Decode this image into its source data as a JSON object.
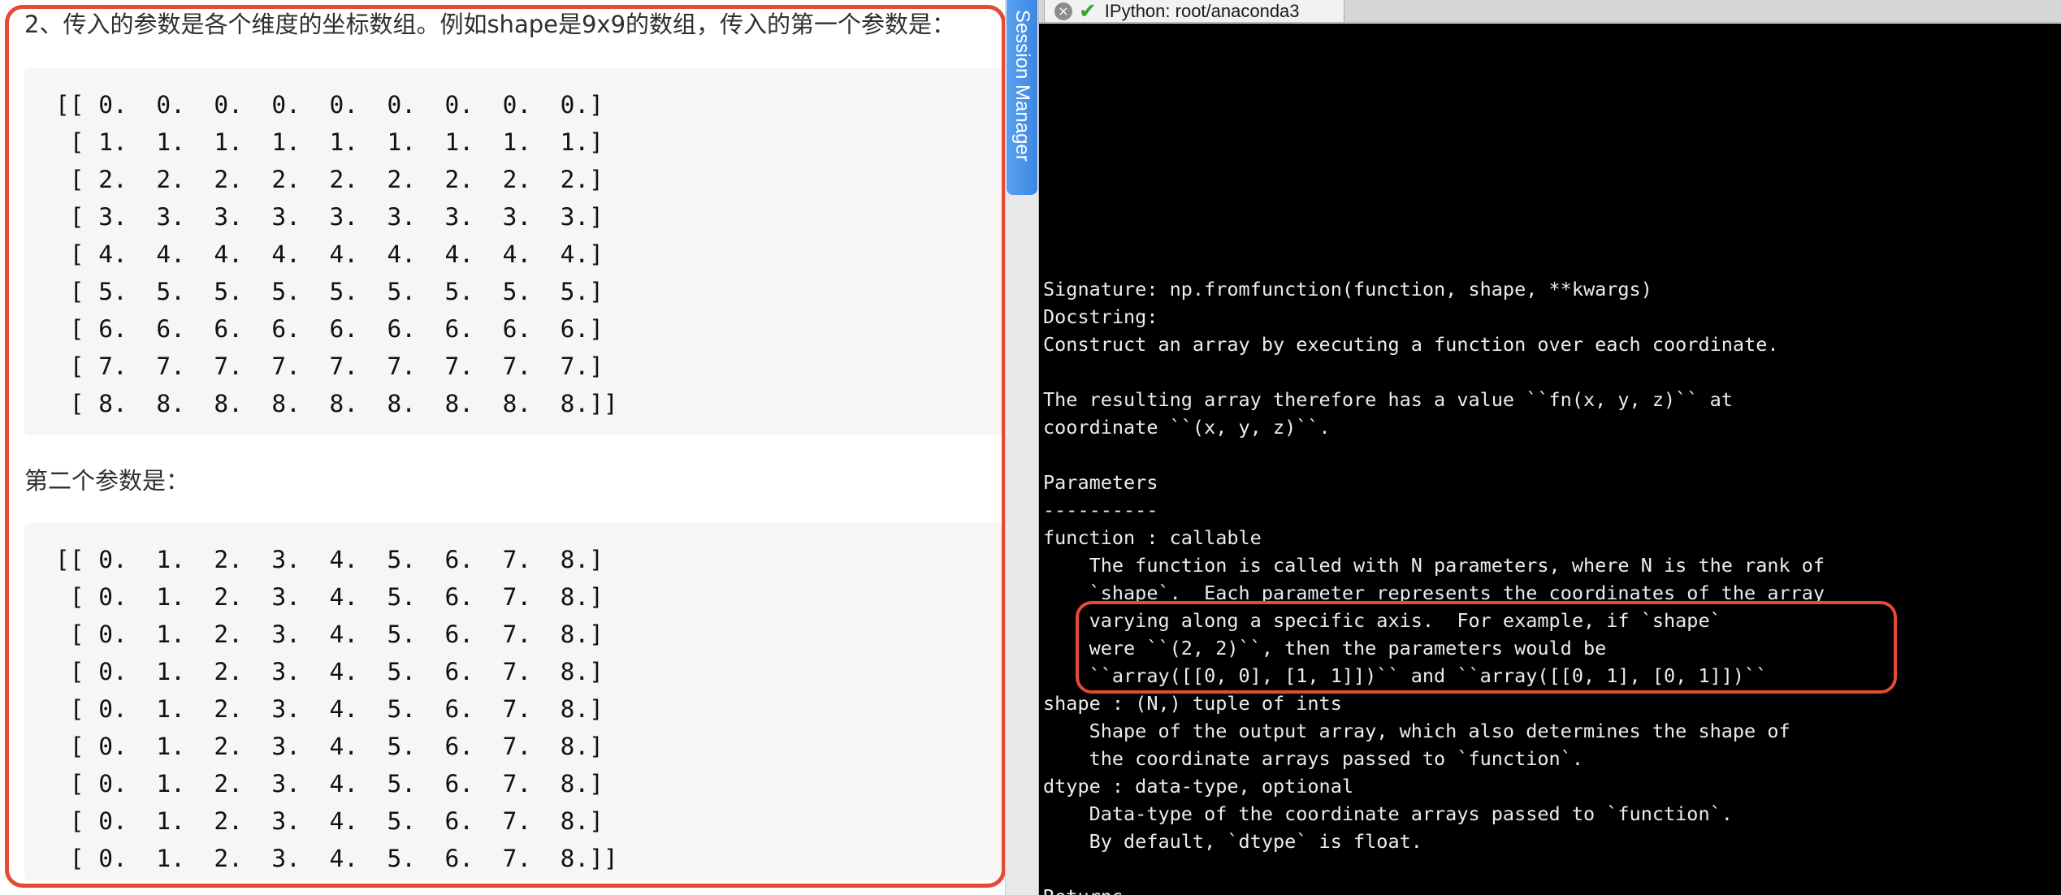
{
  "article": {
    "para1": "2、传入的参数是各个维度的坐标数组。例如shape是9x9的数组，传入的第一个参数是：",
    "code1": [
      "[[ 0.  0.  0.  0.  0.  0.  0.  0.  0.]",
      " [ 1.  1.  1.  1.  1.  1.  1.  1.  1.]",
      " [ 2.  2.  2.  2.  2.  2.  2.  2.  2.]",
      " [ 3.  3.  3.  3.  3.  3.  3.  3.  3.]",
      " [ 4.  4.  4.  4.  4.  4.  4.  4.  4.]",
      " [ 5.  5.  5.  5.  5.  5.  5.  5.  5.]",
      " [ 6.  6.  6.  6.  6.  6.  6.  6.  6.]",
      " [ 7.  7.  7.  7.  7.  7.  7.  7.  7.]",
      " [ 8.  8.  8.  8.  8.  8.  8.  8.  8.]]"
    ],
    "para2": "第二个参数是：",
    "code2": [
      "[[ 0.  1.  2.  3.  4.  5.  6.  7.  8.]",
      " [ 0.  1.  2.  3.  4.  5.  6.  7.  8.]",
      " [ 0.  1.  2.  3.  4.  5.  6.  7.  8.]",
      " [ 0.  1.  2.  3.  4.  5.  6.  7.  8.]",
      " [ 0.  1.  2.  3.  4.  5.  6.  7.  8.]",
      " [ 0.  1.  2.  3.  4.  5.  6.  7.  8.]",
      " [ 0.  1.  2.  3.  4.  5.  6.  7.  8.]",
      " [ 0.  1.  2.  3.  4.  5.  6.  7.  8.]",
      " [ 0.  1.  2.  3.  4.  5.  6.  7.  8.]]"
    ]
  },
  "session_manager": {
    "label": "Session Manager"
  },
  "terminal_tab": {
    "title": "IPython: root/anaconda3",
    "close_icon": "×",
    "status_icon": "✔"
  },
  "terminal": {
    "lines": [
      "Signature: np.fromfunction(function, shape, **kwargs)",
      "Docstring:",
      "Construct an array by executing a function over each coordinate.",
      "",
      "The resulting array therefore has a value ``fn(x, y, z)`` at",
      "coordinate ``(x, y, z)``.",
      "",
      "Parameters",
      "----------",
      "function : callable",
      "    The function is called with N parameters, where N is the rank of",
      "    `shape`.  Each parameter represents the coordinates of the array",
      "    varying along a specific axis.  For example, if `shape`",
      "    were ``(2, 2)``, then the parameters would be",
      "    ``array([[0, 0], [1, 1]])`` and ``array([[0, 1], [0, 1]])``",
      "shape : (N,) tuple of ints",
      "    Shape of the output array, which also determines the shape of",
      "    the coordinate arrays passed to `function`.",
      "dtype : data-type, optional",
      "    Data-type of the coordinate arrays passed to `function`.",
      "    By default, `dtype` is float.",
      "",
      "Returns"
    ]
  },
  "colors": {
    "highlight": "#e54a35",
    "terminal_bg": "#000000",
    "terminal_fg": "#ececec",
    "session_tab": "#3b86e3",
    "code_bg": "#f6f6f6"
  }
}
